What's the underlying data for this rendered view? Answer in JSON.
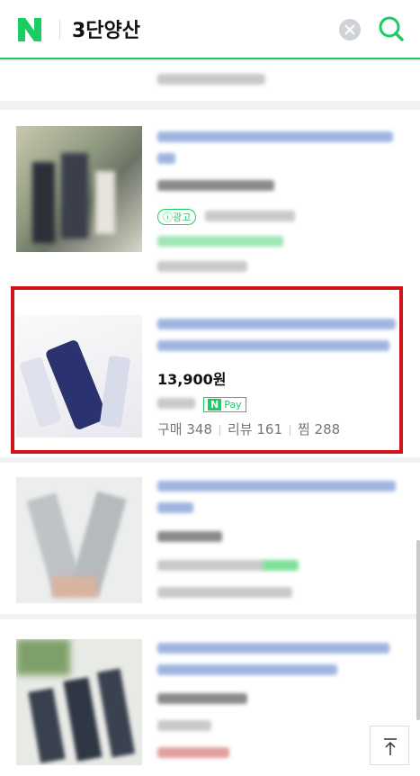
{
  "header": {
    "logo_letter": "N",
    "query": "3단양산",
    "brand_color": "#19ce60"
  },
  "icons": {
    "clear": "close-icon",
    "search": "search-icon",
    "scroll_top": "arrow-up-icon"
  },
  "product": {
    "price": "13,900원",
    "pay_badge_n": "N",
    "pay_badge_text": "Pay",
    "stats": [
      {
        "label": "구매 348"
      },
      {
        "label": "리뷰 161"
      },
      {
        "label": "찜 288"
      }
    ]
  }
}
